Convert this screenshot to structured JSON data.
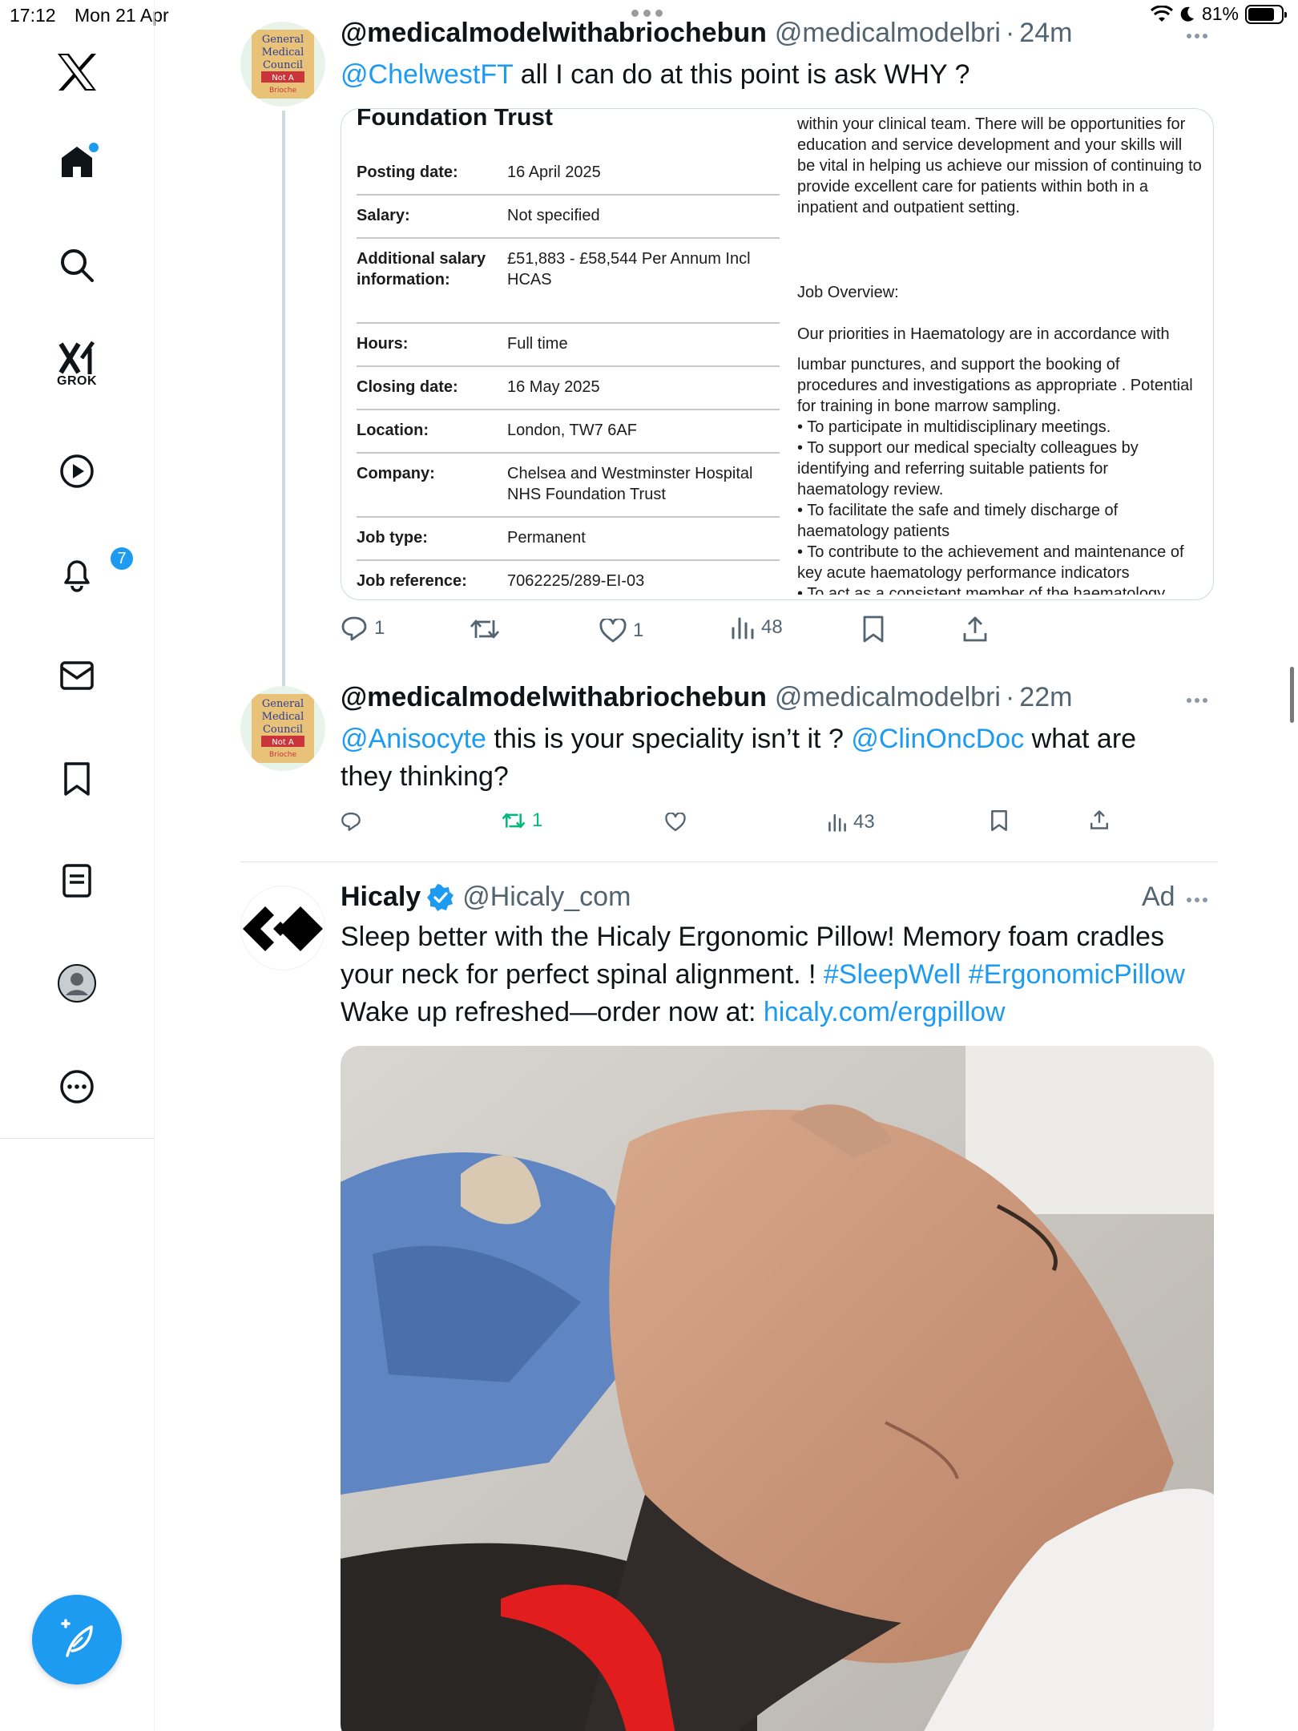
{
  "status_bar": {
    "time": "17:12",
    "date": "Mon 21 Apr",
    "battery": "81%",
    "battery_level": 0.81
  },
  "sidebar": {
    "grok_label": "GROK",
    "notifications_badge": "7",
    "items": [
      "x-logo",
      "home-icon",
      "search-icon",
      "grok-icon",
      "play-icon",
      "bell-icon",
      "mail-icon",
      "bookmark-icon",
      "list-icon",
      "profile-icon",
      "more-icon"
    ]
  },
  "tweets": [
    {
      "name": "@medicalmodelwithabriochebun",
      "handle": "@medicalmodelbri",
      "time": "24m",
      "mention": "@ChelwestFT",
      "text_rest": " all I can do at this point is ask WHY ?",
      "job_card": {
        "title": "Foundation Trust",
        "rows": [
          {
            "label": "Posting date:",
            "value": "16 April 2025"
          },
          {
            "label": "Salary:",
            "value": "Not specified"
          },
          {
            "label": "Additional salary information:",
            "value": "£51,883 - £58,544 Per Annum Incl HCAS"
          },
          {
            "label": "Hours:",
            "value": "Full time"
          },
          {
            "label": "Closing date:",
            "value": "16 May 2025"
          },
          {
            "label": "Location:",
            "value": "London, TW7 6AF"
          },
          {
            "label": "Company:",
            "value": "Chelsea and Westminster Hospital NHS Foundation Trust"
          },
          {
            "label": "Job type:",
            "value": "Permanent"
          },
          {
            "label": "Job reference:",
            "value": "7062225/289-EI-03"
          }
        ],
        "right_top": "within your clinical team. There will be opportunities for education and service development and your skills will be vital in helping us achieve our mission of continuing to provide excellent care for patients within both in a inpatient and outpatient setting.",
        "right_overview": "Job Overview:",
        "right_priorities": "Our priorities in Haematology are in accordance with",
        "right_bottom": "lumbar punctures, and support the booking of procedures and investigations as appropriate . Potential for training in bone marrow sampling.\n• To participate in multidisciplinary meetings.\n• To support our medical specialty colleagues by identifying and referring suitable patients for haematology review.\n• To facilitate the safe and timely discharge of haematology patients\n• To contribute to the achievement and maintenance of key acute haematology performance indicators\n• To act as a consistent member of the haematology"
      },
      "stats": {
        "replies": "1",
        "retweets": "",
        "likes": "1",
        "views": "48"
      }
    },
    {
      "name": "@medicalmodelwithabriochebun",
      "handle": "@medicalmodelbri",
      "time": "22m",
      "mention1": "@Anisocyte",
      "text_mid": " this is your speciality isn’t it  ? ",
      "mention2": "@ClinOncDoc",
      "text_end": " what are",
      "text_line2": "they thinking?",
      "stats": {
        "replies": "",
        "retweets": "1",
        "likes": "",
        "views": "43"
      }
    },
    {
      "name": "Hicaly",
      "handle": "@Hicaly_com",
      "ad_label": "Ad",
      "line1": "Sleep better with the Hicaly Ergonomic Pillow! Memory foam cradles",
      "line2_text": "your neck for perfect spinal alignment. ! ",
      "hashtag1": "#SleepWell",
      "hashtag2": "#ErgonomicPillow",
      "line3_text": "Wake up refreshed—order now at: ",
      "url": "hicaly.com/ergpillow"
    }
  ],
  "avatar_text": {
    "line1": "General",
    "line2": "Medical",
    "line3": "Council",
    "line4": "Not A",
    "line5": "Brioche"
  },
  "colors": {
    "accent": "#1d9bf0",
    "retweet_green": "#00ba7c",
    "muted": "#536471"
  }
}
